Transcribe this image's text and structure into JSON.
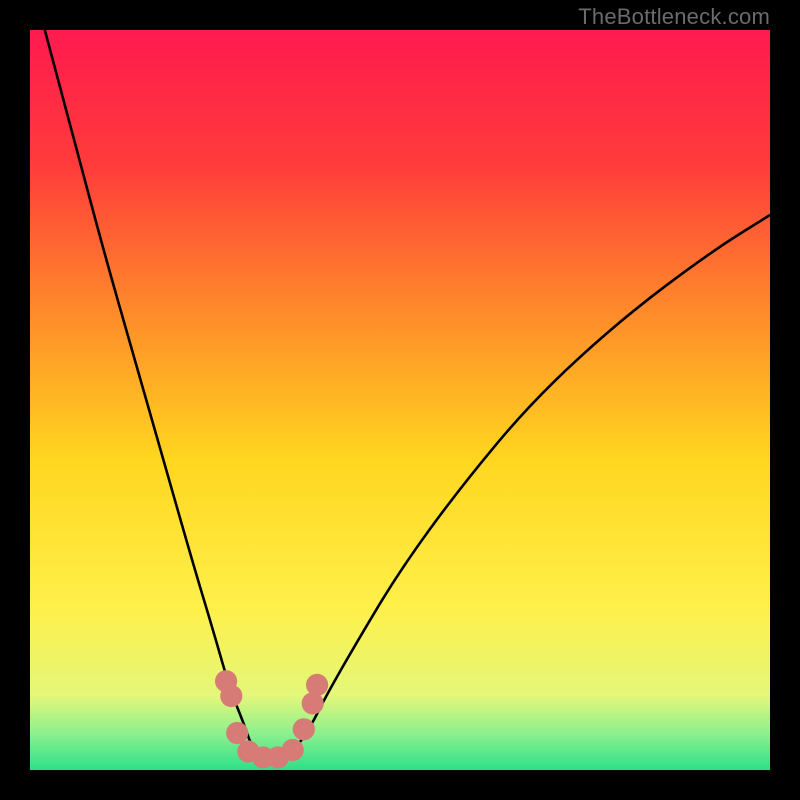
{
  "watermark": "TheBottleneck.com",
  "colors": {
    "background": "#000000",
    "gradient_stops": [
      {
        "pct": 0,
        "color": "#ff1a4f"
      },
      {
        "pct": 18,
        "color": "#ff3b3b"
      },
      {
        "pct": 38,
        "color": "#ff8a2a"
      },
      {
        "pct": 58,
        "color": "#ffd61f"
      },
      {
        "pct": 78,
        "color": "#fff04a"
      },
      {
        "pct": 90,
        "color": "#e3f77a"
      },
      {
        "pct": 95,
        "color": "#8ef08e"
      },
      {
        "pct": 100,
        "color": "#2de08a"
      }
    ],
    "curve": "#000000",
    "markers": "#d77b77"
  },
  "chart_data": {
    "type": "line",
    "title": "",
    "xlabel": "",
    "ylabel": "",
    "xlim": [
      0,
      100
    ],
    "ylim": [
      0,
      100
    ],
    "note": "Values are read off the plot in percent of the inner plot area. y is drawn downward from the top (y=0 at top, y=100 at bottom). The curve represents a bottleneck metric that reaches ~0 (bottom, green) near x≈30–35 and rises toward the top (red) away from that minimum.",
    "series": [
      {
        "name": "bottleneck-curve",
        "x": [
          2,
          6,
          10,
          14,
          18,
          22,
          25,
          27,
          29,
          30,
          32,
          34,
          36,
          38,
          40,
          44,
          50,
          58,
          68,
          80,
          92,
          100
        ],
        "y": [
          0,
          15,
          30,
          44,
          58,
          72,
          82,
          89,
          94,
          97,
          98,
          98,
          97,
          94,
          90,
          83,
          73,
          62,
          50,
          39,
          30,
          25
        ]
      }
    ],
    "markers": {
      "name": "highlight-dots",
      "points": [
        {
          "x": 26.5,
          "y": 88
        },
        {
          "x": 27.2,
          "y": 90
        },
        {
          "x": 28.0,
          "y": 95
        },
        {
          "x": 29.5,
          "y": 97.5
        },
        {
          "x": 31.5,
          "y": 98.3
        },
        {
          "x": 33.5,
          "y": 98.3
        },
        {
          "x": 35.5,
          "y": 97.3
        },
        {
          "x": 37.0,
          "y": 94.5
        },
        {
          "x": 38.2,
          "y": 91
        },
        {
          "x": 38.8,
          "y": 88.5
        }
      ],
      "radius_pct": 1.5
    }
  }
}
